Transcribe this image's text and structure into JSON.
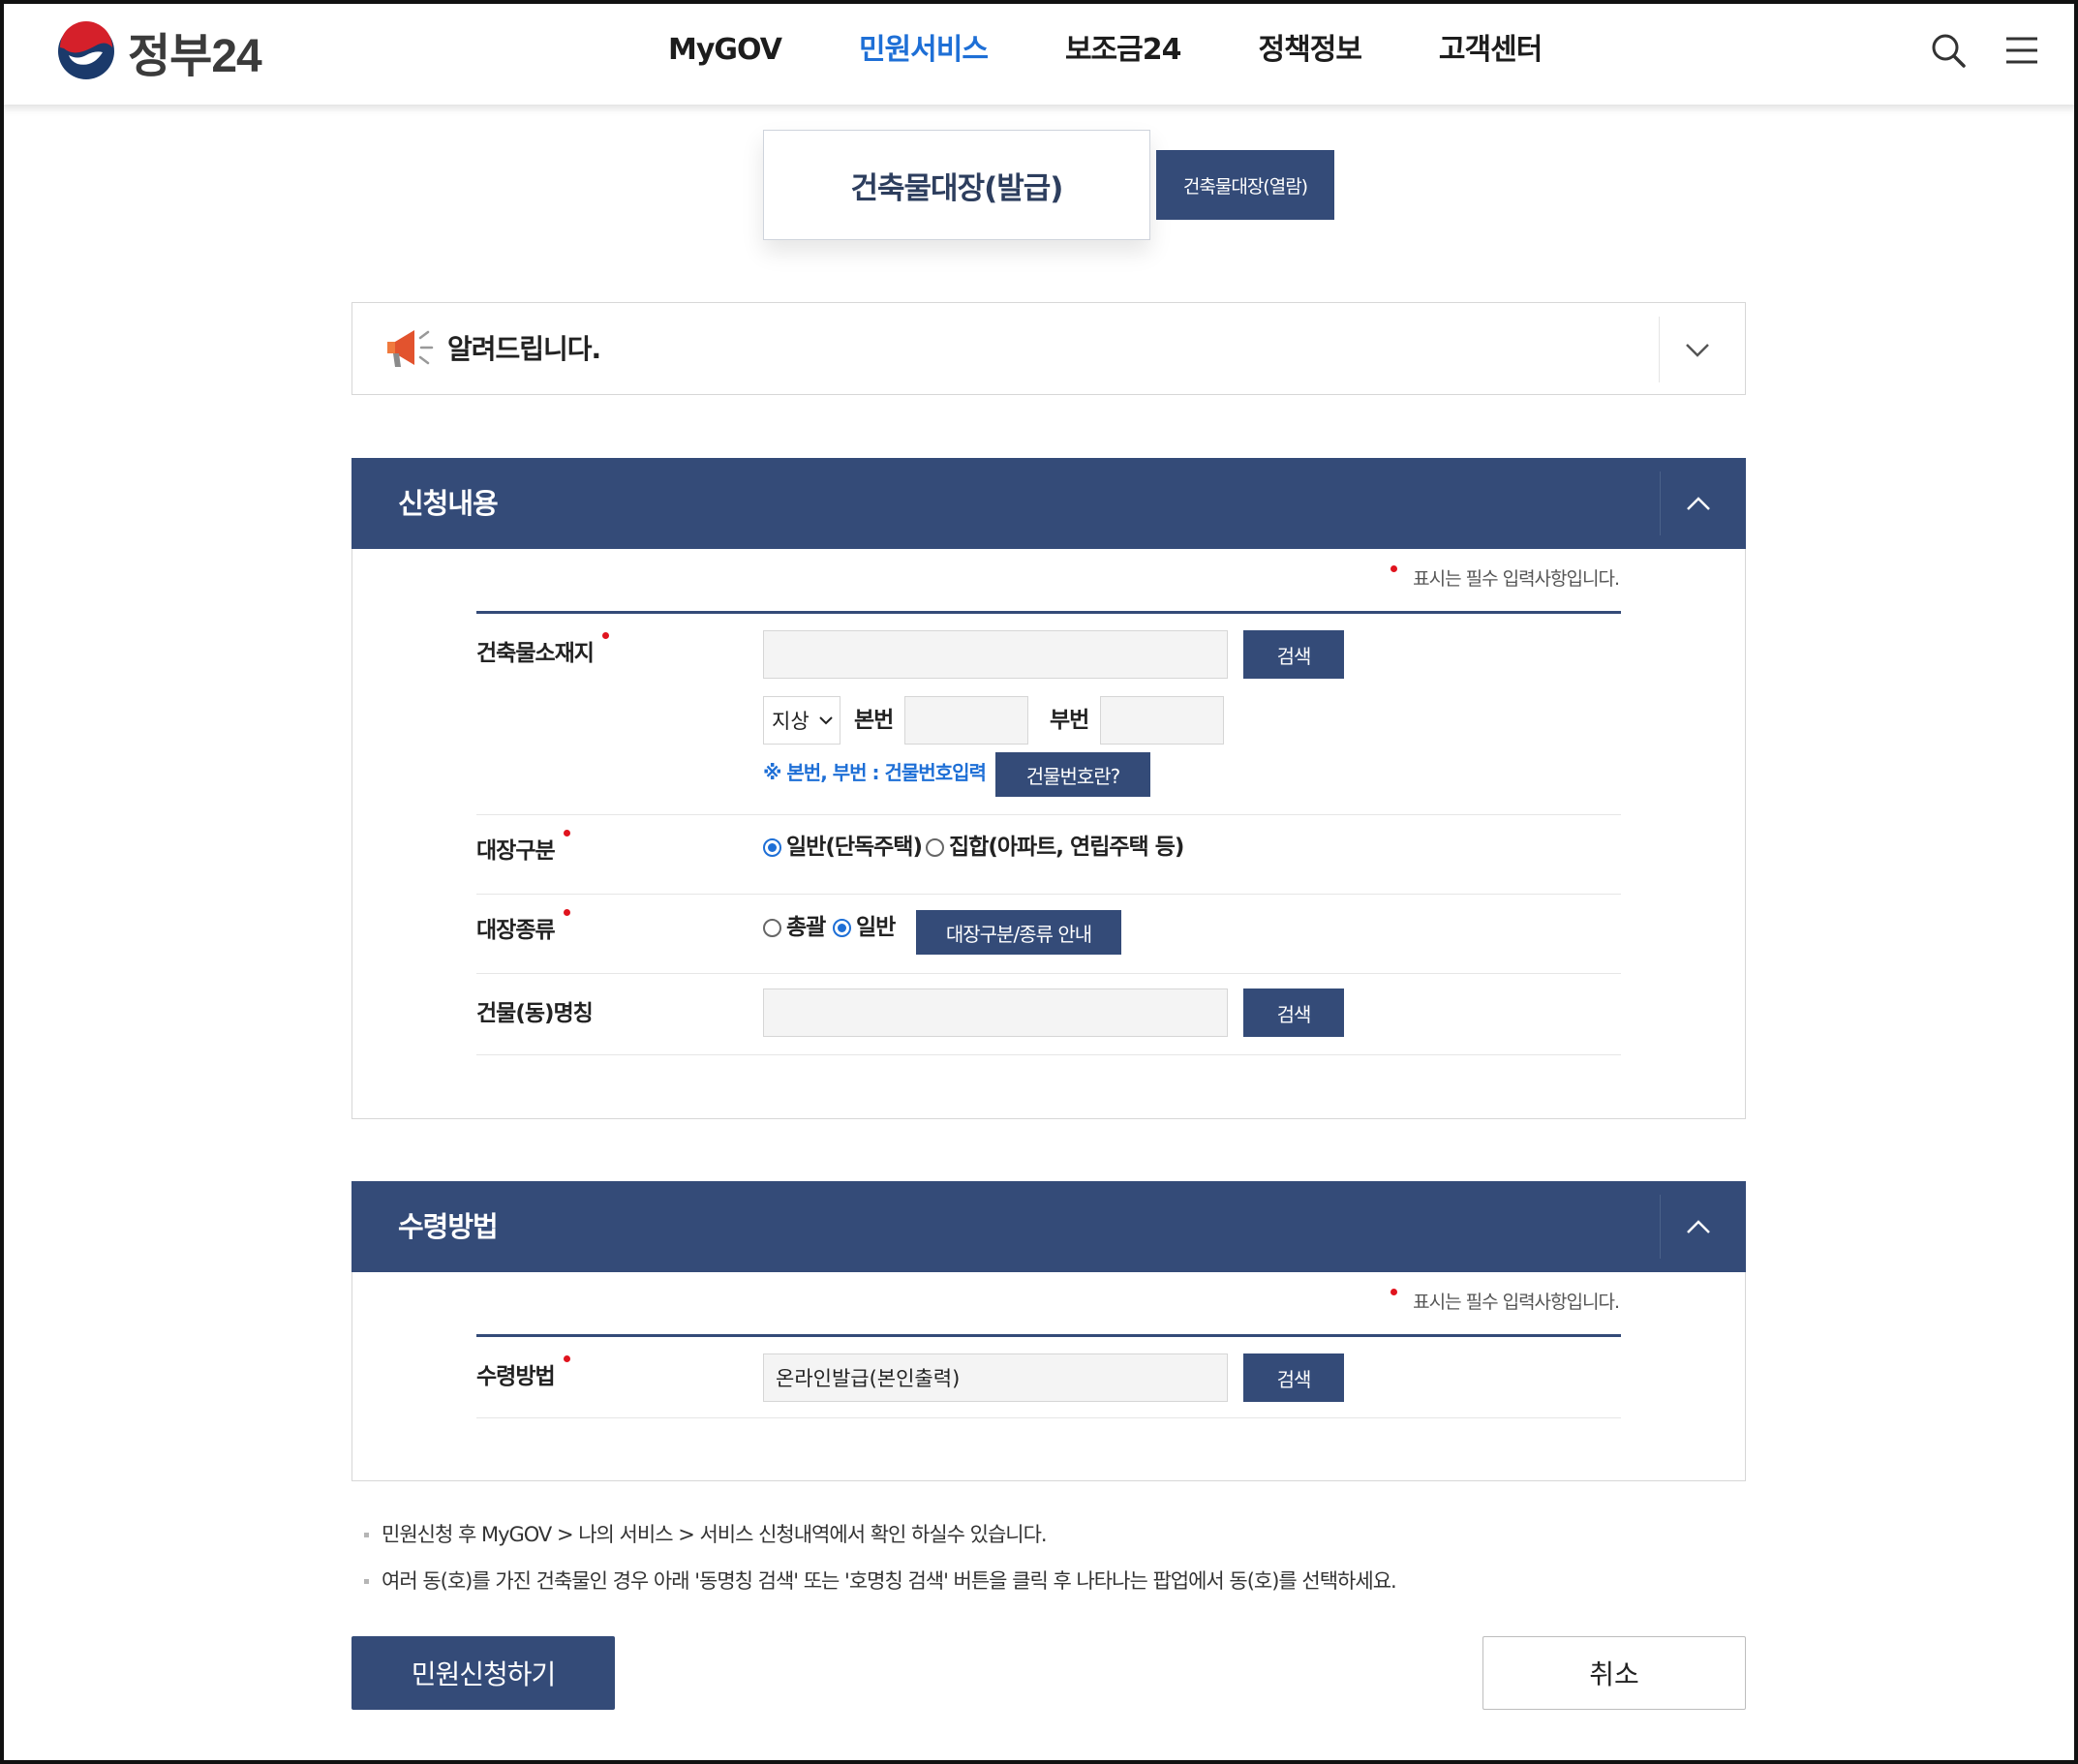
{
  "header": {
    "logo_text": "정부24",
    "nav": [
      {
        "label": "MyGOV"
      },
      {
        "label": "민원서비스"
      },
      {
        "label": "보조금24"
      },
      {
        "label": "정책정보"
      },
      {
        "label": "고객센터"
      }
    ],
    "active_nav": "민원서비스",
    "icons": [
      "search-icon",
      "menu-icon"
    ]
  },
  "tabs": {
    "active_label": "건축물대장(발급)",
    "inactive_label": "건축물대장(열람)"
  },
  "notice": {
    "title": "알려드립니다.",
    "icon": "megaphone-icon"
  },
  "application": {
    "title": "신청내용",
    "required_note": "표시는 필수 입력사항입니다.",
    "location": {
      "label": "건축물소재지",
      "value": "",
      "search_label": "검색",
      "ground_select": "지상",
      "main_no_label": "본번",
      "main_no_value": "",
      "sub_no_label": "부번",
      "sub_no_value": "",
      "hint": "※ 본번, 부번 : 건물번호입력",
      "help_button": "건물번호란?"
    },
    "ledger_class": {
      "label": "대장구분",
      "options": [
        {
          "label": "일반(단독주택)",
          "checked": true
        },
        {
          "label": "집합(아파트, 연립주택 등)",
          "checked": false
        }
      ]
    },
    "ledger_type": {
      "label": "대장종류",
      "options": [
        {
          "label": "총괄",
          "checked": false
        },
        {
          "label": "일반",
          "checked": true
        }
      ],
      "guide_button": "대장구분/종류 안내"
    },
    "building_name": {
      "label": "건물(동)명칭",
      "value": "",
      "search_label": "검색"
    }
  },
  "receipt": {
    "title": "수령방법",
    "required_note": "표시는 필수 입력사항입니다.",
    "method": {
      "label": "수령방법",
      "value": "온라인발급(본인출력)",
      "search_label": "검색"
    }
  },
  "notes": [
    "민원신청 후 MyGOV > 나의 서비스 > 서비스 신청내역에서 확인 하실수 있습니다.",
    "여러 동(호)를 가진 건축물인 경우 아래 '동명칭 검색' 또는 '호명칭 검색' 버튼을 클릭 후 나타나는 팝업에서 동(호)를 선택하세요."
  ],
  "actions": {
    "submit_label": "민원신청하기",
    "cancel_label": "취소"
  },
  "colors": {
    "primary": "#344b78",
    "accent": "#1e6fd6",
    "required": "#e0141e"
  }
}
